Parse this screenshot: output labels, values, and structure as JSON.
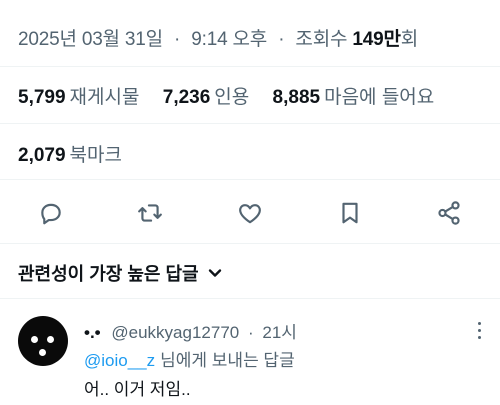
{
  "post_meta": {
    "date": "2025년 03월 31일",
    "separator": "·",
    "time": "9:14 오후",
    "views_label": "조회수",
    "views_count": "149만",
    "views_suffix": "회"
  },
  "stats": [
    {
      "count": "5,799",
      "label": "재게시물"
    },
    {
      "count": "7,236",
      "label": "인용"
    },
    {
      "count": "8,885",
      "label": "마음에 들어요"
    }
  ],
  "bookmarks": {
    "count": "2,079",
    "label": "북마크"
  },
  "actions": [
    {
      "name": "reply-icon"
    },
    {
      "name": "repost-icon"
    },
    {
      "name": "like-icon"
    },
    {
      "name": "bookmark-icon"
    },
    {
      "name": "share-icon"
    }
  ],
  "sort": {
    "label": "관련성이 가장 높은 답글",
    "icon": "chevron-down-icon"
  },
  "reply": {
    "display_name": "•.•",
    "handle": "@eukkyag12770",
    "separator": "·",
    "time": "21시",
    "replying_to": "@ioio__z",
    "replying_suffix": "님에게 보내는 답글",
    "text": "어.. 이거 저임..",
    "more_icon": "more-vertical-icon"
  },
  "colors": {
    "text": "#0f1419",
    "muted": "#536471",
    "accent": "#1d9bf0",
    "divider": "#eff3f4"
  }
}
